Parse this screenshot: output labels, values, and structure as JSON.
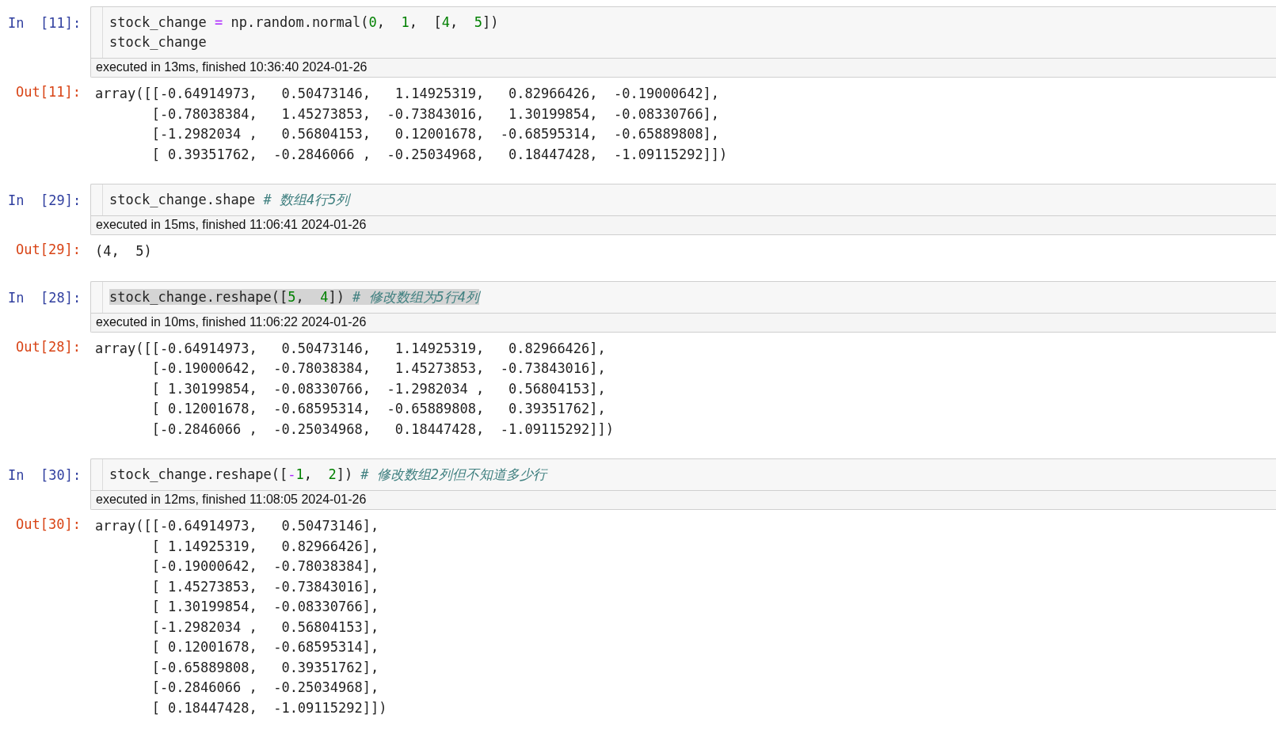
{
  "cells": [
    {
      "in_prompt": "In  [11]:",
      "code_lines": [
        {
          "highlighted": false,
          "tokens": [
            {
              "kind": "name",
              "text": "stock_change "
            },
            {
              "kind": "op",
              "text": "="
            },
            {
              "kind": "name",
              "text": " np.random.normal("
            },
            {
              "kind": "num",
              "text": "0"
            },
            {
              "kind": "name",
              "text": ",  "
            },
            {
              "kind": "num",
              "text": "1"
            },
            {
              "kind": "name",
              "text": ",  ["
            },
            {
              "kind": "num",
              "text": "4"
            },
            {
              "kind": "name",
              "text": ",  "
            },
            {
              "kind": "num",
              "text": "5"
            },
            {
              "kind": "name",
              "text": "])"
            }
          ]
        },
        {
          "highlighted": false,
          "tokens": [
            {
              "kind": "name",
              "text": "stock_change"
            }
          ]
        }
      ],
      "timing": "executed in 13ms, finished 10:36:40 2024-01-26",
      "out_prompt": "Out[11]:",
      "output": [
        "array([[-0.64914973,   0.50473146,   1.14925319,   0.82966426,  -0.19000642],",
        "       [-0.78038384,   1.45273853,  -0.73843016,   1.30199854,  -0.08330766],",
        "       [-1.2982034 ,   0.56804153,   0.12001678,  -0.68595314,  -0.65889808],",
        "       [ 0.39351762,  -0.2846066 ,  -0.25034968,   0.18447428,  -1.09115292]])"
      ]
    },
    {
      "in_prompt": "In  [29]:",
      "code_lines": [
        {
          "highlighted": false,
          "tokens": [
            {
              "kind": "name",
              "text": "stock_change.shape "
            },
            {
              "kind": "comment",
              "text": "# 数组4行5列"
            }
          ]
        }
      ],
      "timing": "executed in 15ms, finished 11:06:41 2024-01-26",
      "out_prompt": "Out[29]:",
      "output": [
        "(4,  5)"
      ]
    },
    {
      "in_prompt": "In  [28]:",
      "code_lines": [
        {
          "highlighted": true,
          "tokens": [
            {
              "kind": "name",
              "text": "stock_change.reshape(["
            },
            {
              "kind": "num",
              "text": "5"
            },
            {
              "kind": "name",
              "text": ",  "
            },
            {
              "kind": "num",
              "text": "4"
            },
            {
              "kind": "name",
              "text": "]) "
            },
            {
              "kind": "comment",
              "text": "# 修改数组为5行4列"
            }
          ]
        }
      ],
      "timing": "executed in 10ms, finished 11:06:22 2024-01-26",
      "out_prompt": "Out[28]:",
      "output": [
        "array([[-0.64914973,   0.50473146,   1.14925319,   0.82966426],",
        "       [-0.19000642,  -0.78038384,   1.45273853,  -0.73843016],",
        "       [ 1.30199854,  -0.08330766,  -1.2982034 ,   0.56804153],",
        "       [ 0.12001678,  -0.68595314,  -0.65889808,   0.39351762],",
        "       [-0.2846066 ,  -0.25034968,   0.18447428,  -1.09115292]])"
      ]
    },
    {
      "in_prompt": "In  [30]:",
      "code_lines": [
        {
          "highlighted": false,
          "tokens": [
            {
              "kind": "name",
              "text": "stock_change.reshape(["
            },
            {
              "kind": "op",
              "text": "-"
            },
            {
              "kind": "num",
              "text": "1"
            },
            {
              "kind": "name",
              "text": ",  "
            },
            {
              "kind": "num",
              "text": "2"
            },
            {
              "kind": "name",
              "text": "]) "
            },
            {
              "kind": "comment",
              "text": "# 修改数组2列但不知道多少行"
            }
          ]
        }
      ],
      "timing": "executed in 12ms, finished 11:08:05 2024-01-26",
      "out_prompt": "Out[30]:",
      "output": [
        "array([[-0.64914973,   0.50473146],",
        "       [ 1.14925319,   0.82966426],",
        "       [-0.19000642,  -0.78038384],",
        "       [ 1.45273853,  -0.73843016],",
        "       [ 1.30199854,  -0.08330766],",
        "       [-1.2982034 ,   0.56804153],",
        "       [ 0.12001678,  -0.68595314],",
        "       [-0.65889808,   0.39351762],",
        "       [-0.2846066 ,  -0.25034968],",
        "       [ 0.18447428,  -1.09115292]])"
      ]
    }
  ]
}
